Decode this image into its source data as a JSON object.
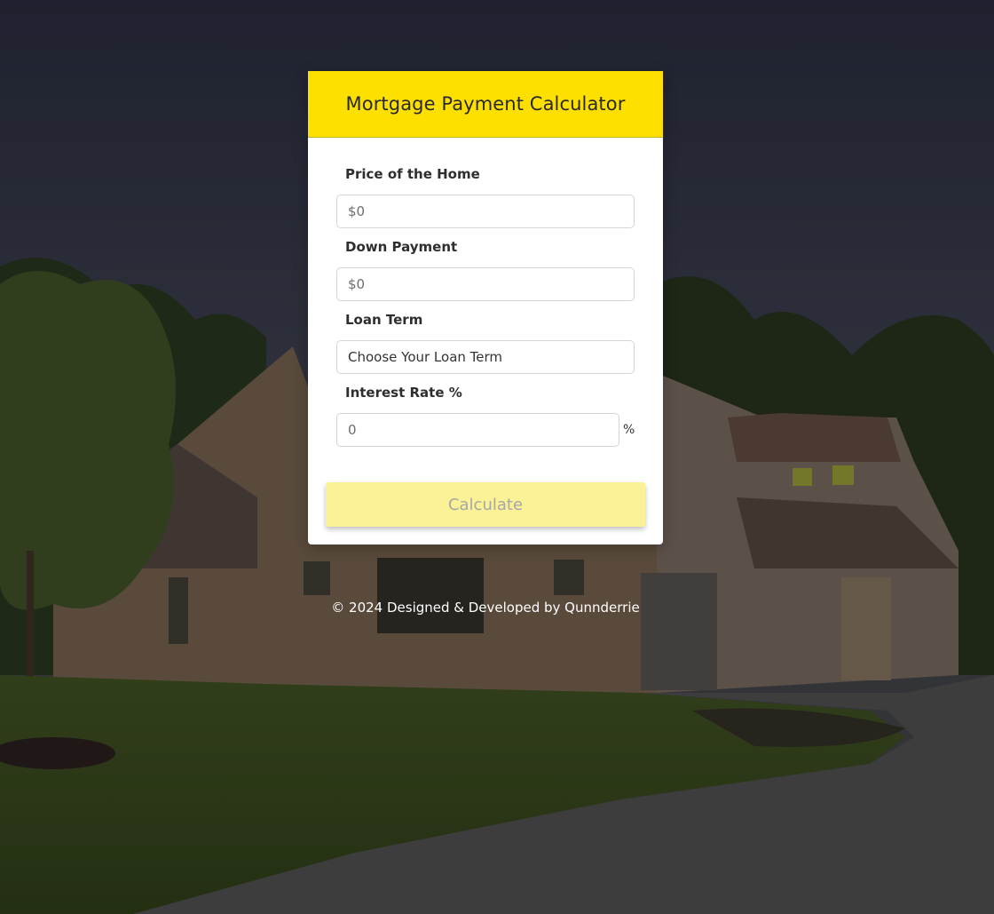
{
  "header": {
    "title": "Mortgage Payment Calculator"
  },
  "form": {
    "price": {
      "label": "Price of the Home",
      "placeholder": "$0",
      "value": ""
    },
    "down_payment": {
      "label": "Down Payment",
      "placeholder": "$0",
      "value": ""
    },
    "loan_term": {
      "label": "Loan Term",
      "selected": "Choose Your Loan Term"
    },
    "interest_rate": {
      "label": "Interest Rate %",
      "placeholder": "0",
      "value": "",
      "suffix": "%"
    },
    "calculate_label": "Calculate"
  },
  "footer": {
    "text": "© 2024 Designed & Developed by Qunnderrie"
  },
  "colors": {
    "header_bg": "#fde000",
    "button_bg": "#fbf196",
    "button_text": "#a7a7a7",
    "card_bg": "#ffffff"
  }
}
